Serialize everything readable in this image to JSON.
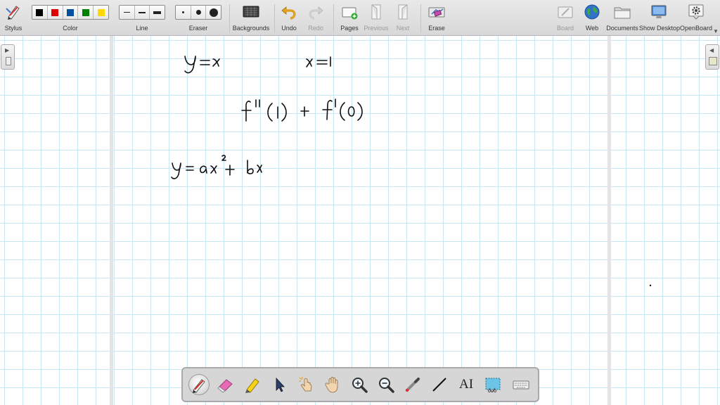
{
  "toolbar": {
    "stylus": "Stylus",
    "color": "Color",
    "line": "Line",
    "eraser": "Eraser",
    "backgrounds": "Backgrounds",
    "undo": "Undo",
    "redo": "Redo",
    "pages": "Pages",
    "previous": "Previous",
    "next": "Next",
    "erase": "Erase",
    "board": "Board",
    "web": "Web",
    "documents": "Documents",
    "show_desktop": "Show Desktop",
    "openboard": "OpenBoard",
    "colors": [
      "#000000",
      "#e00000",
      "#0050a0",
      "#008000",
      "#ffd800"
    ]
  },
  "board": {
    "grid_color": "#c9e6f5",
    "ink_color": "#111111",
    "handwriting": {
      "line1": "y =x",
      "line1b": "x =1",
      "line2": "f''(1) + f'(0)",
      "line3": "y = ax² + bx"
    }
  },
  "dock": {
    "tools": [
      "pen-tool",
      "eraser-tool",
      "highlighter-tool",
      "select-tool",
      "interact-tool",
      "hand-tool",
      "zoom-in-tool",
      "zoom-out-tool",
      "laser-tool",
      "line-tool",
      "text-tool",
      "capture-tool",
      "keyboard-tool"
    ],
    "text_tool_label": "AI"
  }
}
